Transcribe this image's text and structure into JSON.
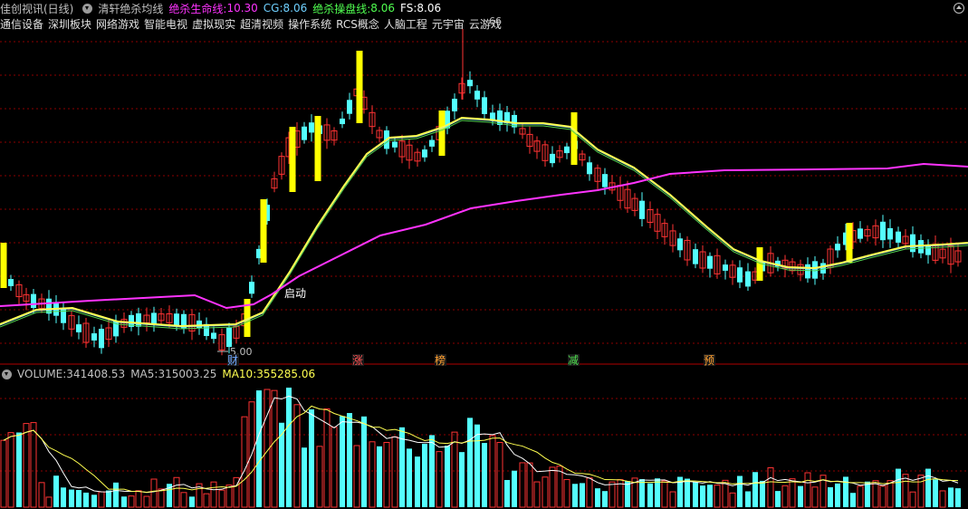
{
  "header": {
    "stock_title": "佳创视讯(日线)",
    "indicator_name": "清轩绝杀均线",
    "label1": "绝杀生命线:",
    "value1": "10.30",
    "label2": "CG:",
    "value2": "8.06",
    "label3": "绝杀操盘线:",
    "value3": "8.06",
    "label4": "FS:",
    "value4": "8.06"
  },
  "concepts": [
    "通信设备",
    "深圳板块",
    "网络游戏",
    "智能电视",
    "虚拟现实",
    "超清视频",
    "操作系统",
    "RCS概念",
    "人脑工程",
    "元宇宙",
    "云游戏"
  ],
  "price_chart": {
    "high_label": "66",
    "low_label": "5.00",
    "signal_label": "启动",
    "event_markers": [
      {
        "text": "财",
        "color": "#6fa8ff"
      },
      {
        "text": "涨",
        "color": "#ff5050"
      },
      {
        "text": "榜",
        "color": "#ffa030"
      },
      {
        "text": "减",
        "color": "#50e050"
      },
      {
        "text": "预",
        "color": "#ffa030"
      }
    ]
  },
  "volume": {
    "label": "VOLUME:",
    "value": "341408.53",
    "ma5_label": "MA5:",
    "ma5_value": "315003.25",
    "ma10_label": "MA10:",
    "ma10_value": "355285.06"
  },
  "colors": {
    "up": "#ff3333",
    "down": "#54ffff",
    "signal": "#ffff00",
    "magenta": "#ff33ff",
    "yellow_line": "#ffff50",
    "grid": "#8b0000"
  }
}
